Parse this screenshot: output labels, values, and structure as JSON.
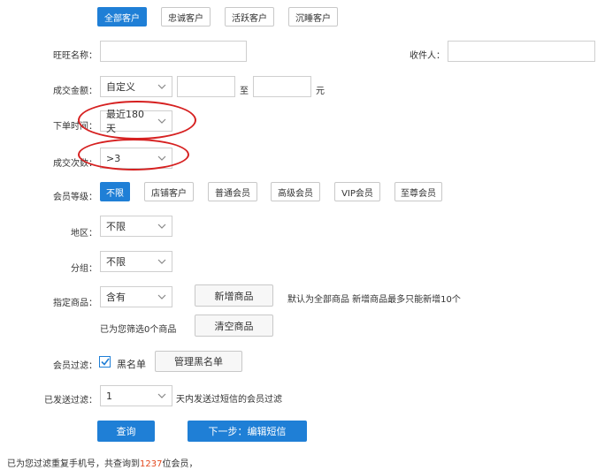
{
  "tabs": [
    {
      "label": "全部客户",
      "active": true
    },
    {
      "label": "忠诚客户",
      "active": false
    },
    {
      "label": "活跃客户",
      "active": false
    },
    {
      "label": "沉睡客户",
      "active": false
    }
  ],
  "fields": {
    "wangwang_label": "旺旺名称：",
    "recipient_label": "收件人：",
    "amount_label": "成交金额：",
    "amount_select": "自定义",
    "amount_to": "至",
    "amount_unit": "元",
    "order_time_label": "下单时间：",
    "order_time_select": "最近180天",
    "deal_count_label": "成交次数：",
    "deal_count_select": ">3",
    "member_level_label": "会员等级：",
    "region_label": "地区：",
    "region_select": "不限",
    "group_label": "分组：",
    "group_select": "不限",
    "product_label": "指定商品：",
    "product_select": "含有",
    "add_product_button": "新增商品",
    "product_hint": "默认为全部商品 新增商品最多只能新增10个",
    "selected_count_text": "已为您筛选0个商品",
    "clear_product_button": "清空商品",
    "member_filter_label": "会员过滤：",
    "blacklist_label": "黑名单",
    "manage_blacklist_button": "管理黑名单",
    "sent_filter_label": "已发送过滤：",
    "sent_filter_select": "1",
    "sent_filter_hint": "天内发送过短信的会员过滤"
  },
  "member_levels": [
    {
      "label": "不限",
      "active": true
    },
    {
      "label": "店铺客户",
      "active": false
    },
    {
      "label": "普通会员",
      "active": false
    },
    {
      "label": "高级会员",
      "active": false
    },
    {
      "label": "VIP会员",
      "active": false
    },
    {
      "label": "至尊会员",
      "active": false
    }
  ],
  "actions": {
    "query_button": "查询",
    "next_button": "下一步：编辑短信"
  },
  "result": {
    "prefix": "已为您过滤重复手机号，共查询到",
    "count": "1237",
    "suffix": "位会员，"
  },
  "colors": {
    "accent": "#1f7fd6",
    "highlight_ellipse": "#d62020",
    "count_text": "#e3481d"
  }
}
